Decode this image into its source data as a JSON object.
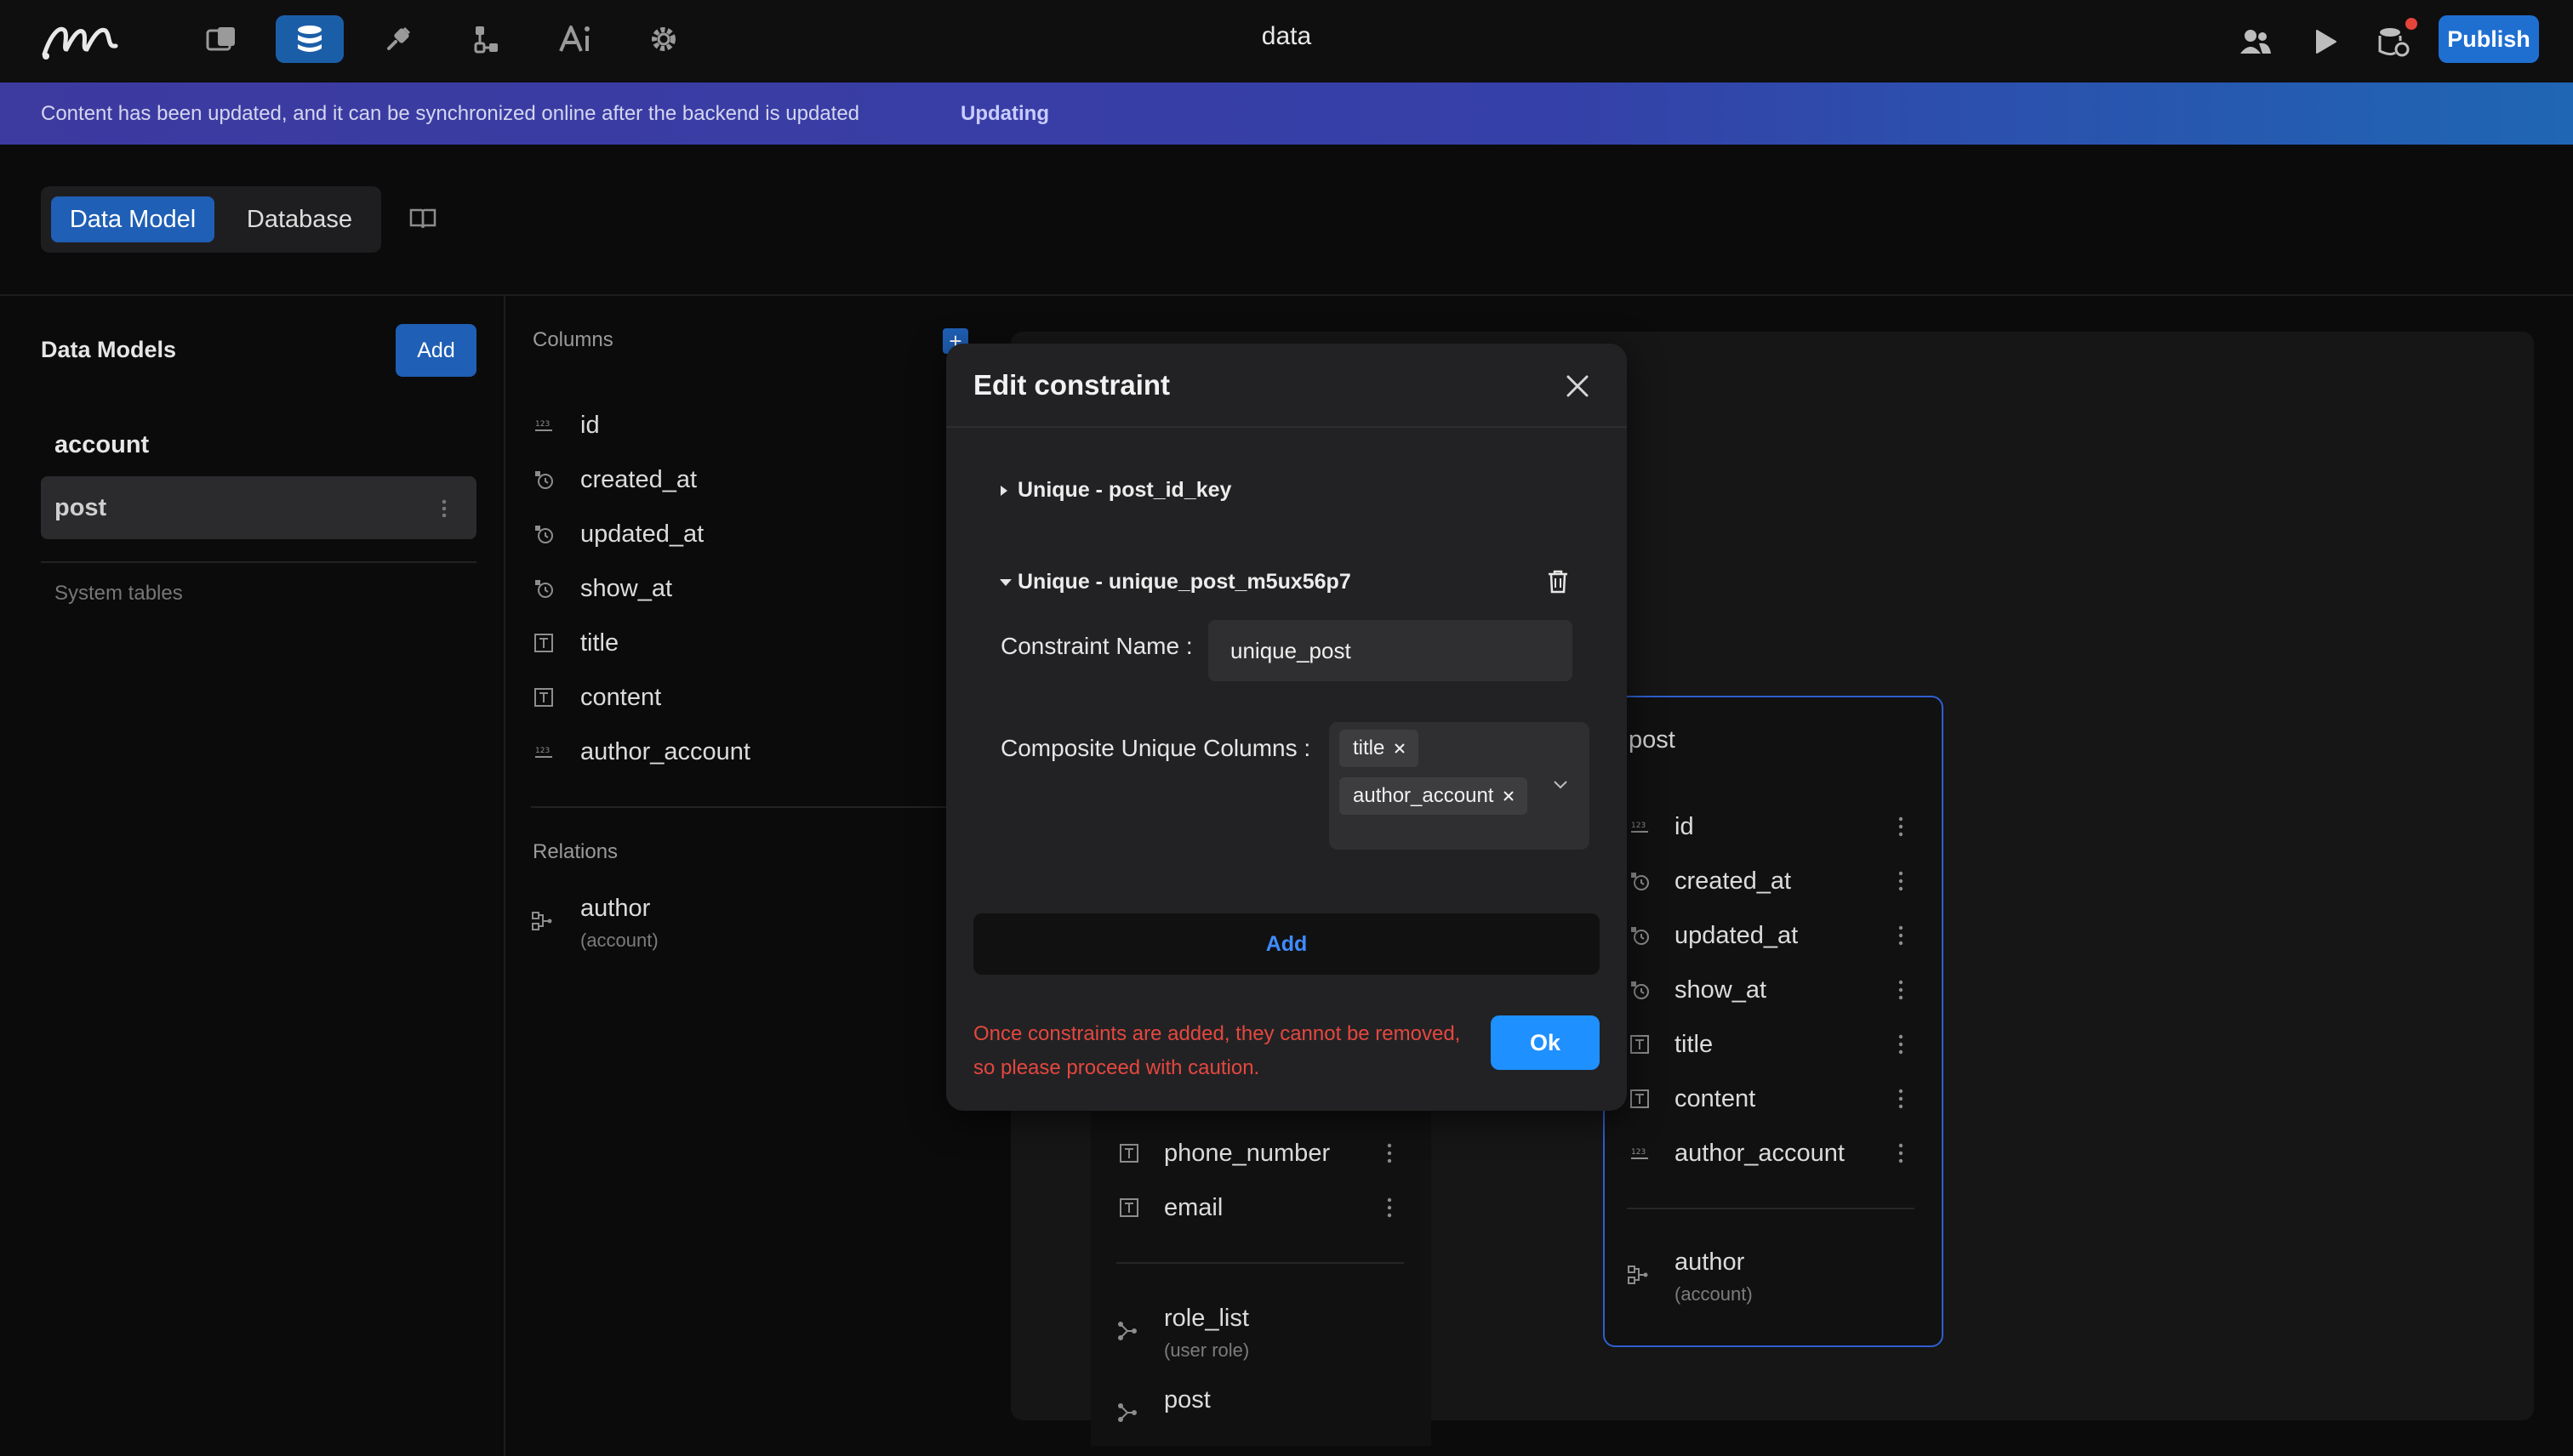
{
  "app": {
    "title": "data",
    "publish_label": "Publish"
  },
  "nav": [
    "logo",
    "pages-icon",
    "database-icon",
    "plugin-icon",
    "flow-icon",
    "ai-icon",
    "settings-icon"
  ],
  "banner": {
    "text": "Content has been updated, and it can be synchronized online after the backend is updated",
    "status": "Updating"
  },
  "mode": {
    "data_model": "Data Model",
    "database": "Database"
  },
  "sidebar": {
    "title": "Data Models",
    "add_label": "Add",
    "items": [
      "account",
      "post"
    ],
    "system_tables": "System tables"
  },
  "columns": {
    "label": "Columns",
    "items": [
      {
        "name": "id",
        "icon": "number-icon"
      },
      {
        "name": "created_at",
        "icon": "datetime-icon"
      },
      {
        "name": "updated_at",
        "icon": "datetime-icon"
      },
      {
        "name": "show_at",
        "icon": "datetime-icon"
      },
      {
        "name": "title",
        "icon": "text-icon"
      },
      {
        "name": "content",
        "icon": "text-icon"
      },
      {
        "name": "author_account",
        "icon": "number-icon"
      }
    ]
  },
  "relations": {
    "label": "Relations",
    "items": [
      {
        "name": "author",
        "sub": "(account)"
      }
    ]
  },
  "canvas": {
    "account_card": {
      "rows": [
        "phone_number",
        "email"
      ],
      "relations": [
        {
          "name": "role_list",
          "sub": "(user role)"
        },
        {
          "name": "post",
          "sub": ""
        }
      ]
    },
    "post_card": {
      "title": "post",
      "rows": [
        "id",
        "created_at",
        "updated_at",
        "show_at",
        "title",
        "content",
        "author_account"
      ],
      "relation": {
        "name": "author",
        "sub": "(account)"
      }
    }
  },
  "modal": {
    "title": "Edit constraint",
    "section1": "Unique - post_id_key",
    "section2": "Unique - unique_post_m5ux56p7",
    "constraint_name_label": "Constraint Name",
    "constraint_name_value": "unique_post",
    "composite_label": "Composite Unique Columns",
    "tags": [
      "title",
      "author_account"
    ],
    "add_label": "Add",
    "warning": "Once constraints are added, they cannot be removed, so please proceed with caution.",
    "ok_label": "Ok"
  },
  "colors": {
    "accent": "#1f5fb5",
    "ok": "#1e90ff",
    "warning": "#e5473f",
    "selection_border": "#2f5fd0"
  }
}
